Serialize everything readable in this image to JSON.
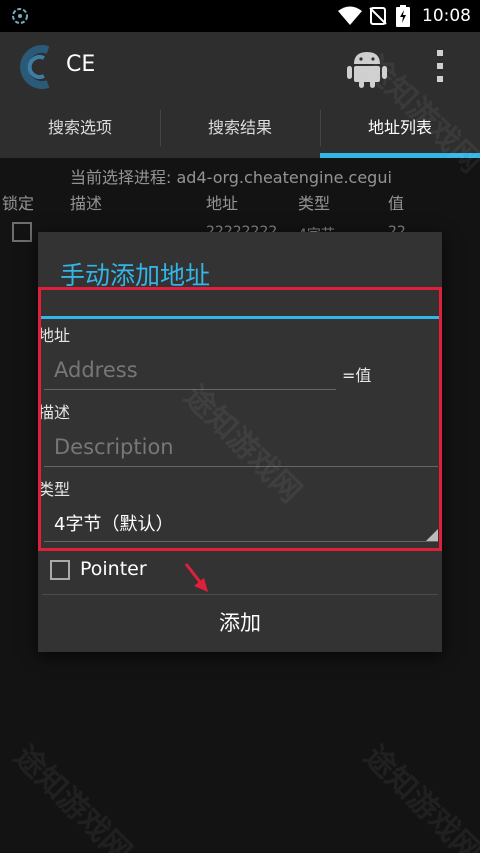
{
  "status_bar": {
    "time": "10:08",
    "icons": [
      "ce-app-icon",
      "wifi-icon",
      "no-sim-icon",
      "battery-charging-icon"
    ]
  },
  "action_bar": {
    "title": "CE",
    "icons": [
      "cheat-engine-logo-icon",
      "android-icon",
      "overflow-menu-icon"
    ]
  },
  "tabs": [
    {
      "label": "搜索选项",
      "active": false
    },
    {
      "label": "搜索结果",
      "active": false
    },
    {
      "label": "地址列表",
      "active": true
    }
  ],
  "address_list": {
    "process_line": "当前选择进程: ad4-org.cheatengine.cegui",
    "columns": [
      "锁定",
      "描述",
      "地址",
      "类型",
      "值"
    ],
    "row": {
      "address": "22222222",
      "type": "4字节",
      "value": "22"
    }
  },
  "dialog": {
    "title": "手动添加地址",
    "address_label": "地址",
    "address_placeholder": "Address",
    "value_label": "=值",
    "description_label": "描述",
    "description_placeholder": "Description",
    "type_label": "类型",
    "type_value": "4字节（默认）",
    "pointer_label": "Pointer",
    "add_button": "添加"
  },
  "watermark": "途知游戏网",
  "colors": {
    "accent": "#33b5e5",
    "highlight": "#e0203a",
    "dialog_bg": "#333333"
  }
}
